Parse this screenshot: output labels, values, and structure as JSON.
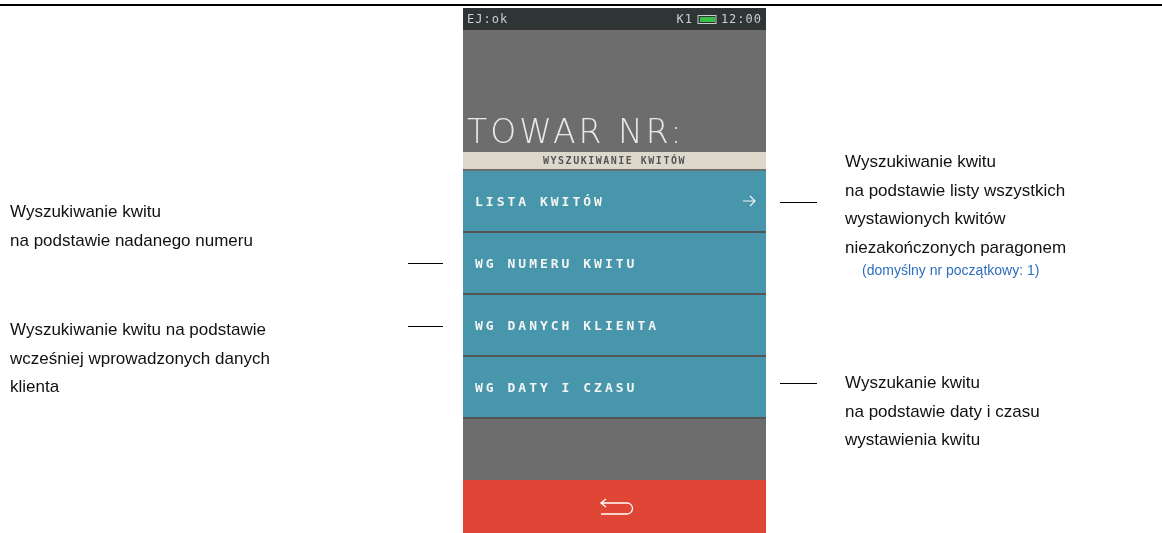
{
  "device": {
    "status_bar": {
      "journal": "EJ:ok",
      "channel": "K1",
      "time": "12:00"
    },
    "prompt": "TOWAR NR:",
    "section_title": "WYSZUKIWANIE KWITÓW",
    "menu": [
      {
        "label": "LISTA KWITÓW",
        "has_arrow": true
      },
      {
        "label": "WG NUMERU KWITU",
        "has_arrow": false
      },
      {
        "label": "WG DANYCH KLIENTA",
        "has_arrow": false
      },
      {
        "label": "WG DATY I CZASU",
        "has_arrow": false
      }
    ]
  },
  "annotations_left": [
    {
      "text": "Wyszukiwanie kwitu\nna podstawie nadanego numeru"
    },
    {
      "text": "Wyszukiwanie kwitu na podstawie\nwcześniej wprowadzonych danych\nklienta"
    }
  ],
  "annotations_right": [
    {
      "text": "Wyszukiwanie kwitu\nna podstawie listy wszystkich\nwystawionych kwitów\nniezakończonych paragonem",
      "note": "(domyślny nr początkowy: 1)"
    },
    {
      "text": "Wyszukanie kwitu\nna podstawie daty i czasu\nwystawienia kwitu"
    }
  ]
}
